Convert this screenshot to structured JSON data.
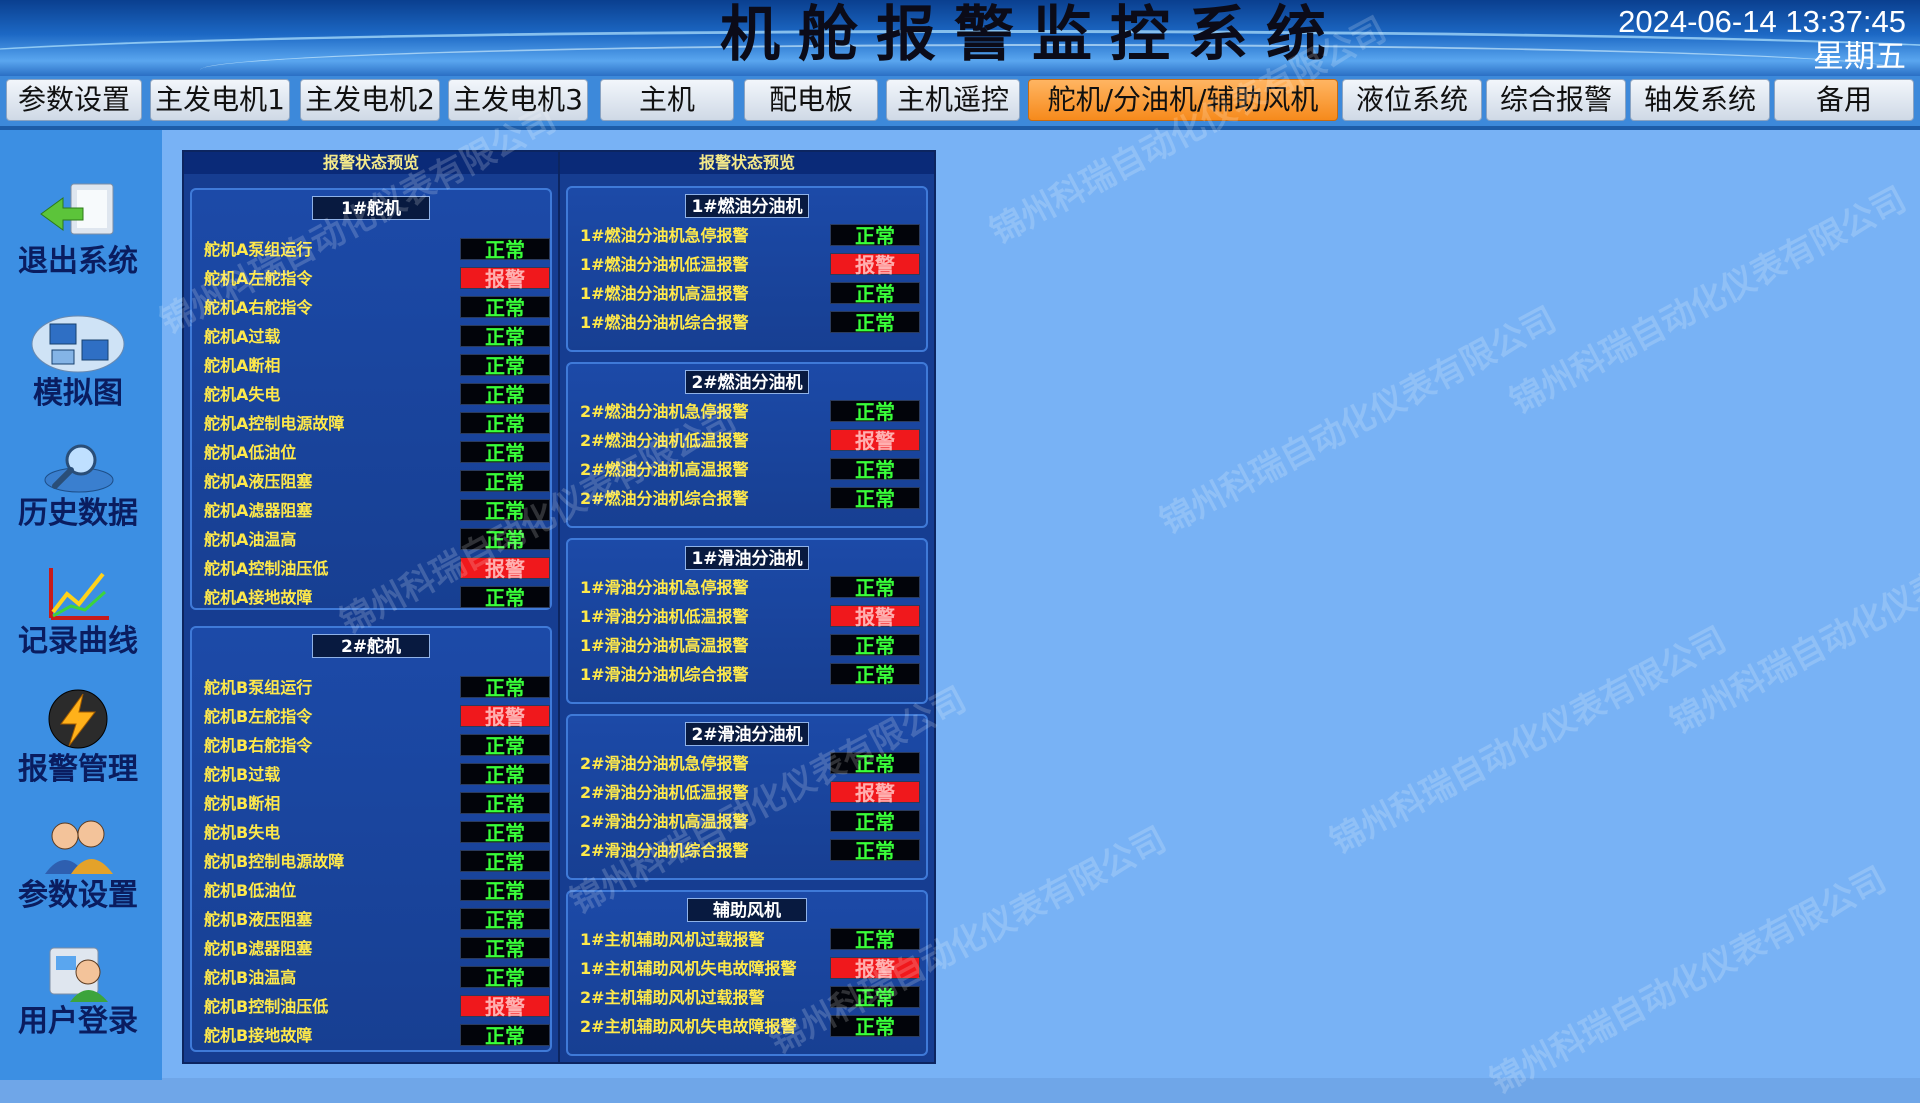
{
  "header": {
    "title": "机舱报警监控系统",
    "datetime": "2024-06-14 13:37:45",
    "weekday": "星期五"
  },
  "nav": {
    "items": [
      "参数设置",
      "主发电机1",
      "主发电机2",
      "主发电机3",
      "主机",
      "配电板",
      "主机遥控",
      "舵机/分油机/辅助风机",
      "液位系统",
      "综合报警",
      "轴发系统",
      "备用"
    ],
    "active_index": 7
  },
  "sidebar": {
    "items": [
      {
        "label": "退出系统",
        "icon": "exit-arrow-icon"
      },
      {
        "label": "模拟图",
        "icon": "monitor-diagram-icon"
      },
      {
        "label": "历史数据",
        "icon": "magnifier-history-icon"
      },
      {
        "label": "记录曲线",
        "icon": "chart-curve-icon"
      },
      {
        "label": "报警管理",
        "icon": "lightning-alarm-icon"
      },
      {
        "label": "参数设置",
        "icon": "users-settings-icon"
      },
      {
        "label": "用户登录",
        "icon": "user-login-icon"
      }
    ]
  },
  "panels": [
    {
      "header": "报警状态预览",
      "groups": [
        {
          "title": "1#舵机",
          "rows": [
            {
              "name": "舵机A泵组运行",
              "status": "正常",
              "alarm": false
            },
            {
              "name": "舵机A左舵指令",
              "status": "报警",
              "alarm": true
            },
            {
              "name": "舵机A右舵指令",
              "status": "正常",
              "alarm": false
            },
            {
              "name": "舵机A过载",
              "status": "正常",
              "alarm": false
            },
            {
              "name": "舵机A断相",
              "status": "正常",
              "alarm": false
            },
            {
              "name": "舵机A失电",
              "status": "正常",
              "alarm": false
            },
            {
              "name": "舵机A控制电源故障",
              "status": "正常",
              "alarm": false
            },
            {
              "name": "舵机A低油位",
              "status": "正常",
              "alarm": false
            },
            {
              "name": "舵机A液压阻塞",
              "status": "正常",
              "alarm": false
            },
            {
              "name": "舵机A滤器阻塞",
              "status": "正常",
              "alarm": false
            },
            {
              "name": "舵机A油温高",
              "status": "正常",
              "alarm": false
            },
            {
              "name": "舵机A控制油压低",
              "status": "报警",
              "alarm": true
            },
            {
              "name": "舵机A接地故障",
              "status": "正常",
              "alarm": false
            }
          ]
        },
        {
          "title": "2#舵机",
          "rows": [
            {
              "name": "舵机B泵组运行",
              "status": "正常",
              "alarm": false
            },
            {
              "name": "舵机B左舵指令",
              "status": "报警",
              "alarm": true
            },
            {
              "name": "舵机B右舵指令",
              "status": "正常",
              "alarm": false
            },
            {
              "name": "舵机B过载",
              "status": "正常",
              "alarm": false
            },
            {
              "name": "舵机B断相",
              "status": "正常",
              "alarm": false
            },
            {
              "name": "舵机B失电",
              "status": "正常",
              "alarm": false
            },
            {
              "name": "舵机B控制电源故障",
              "status": "正常",
              "alarm": false
            },
            {
              "name": "舵机B低油位",
              "status": "正常",
              "alarm": false
            },
            {
              "name": "舵机B液压阻塞",
              "status": "正常",
              "alarm": false
            },
            {
              "name": "舵机B滤器阻塞",
              "status": "正常",
              "alarm": false
            },
            {
              "name": "舵机B油温高",
              "status": "正常",
              "alarm": false
            },
            {
              "name": "舵机B控制油压低",
              "status": "报警",
              "alarm": true
            },
            {
              "name": "舵机B接地故障",
              "status": "正常",
              "alarm": false
            }
          ]
        }
      ]
    },
    {
      "header": "报警状态预览",
      "groups": [
        {
          "title": "1#燃油分油机",
          "rows": [
            {
              "name": "1#燃油分油机急停报警",
              "status": "正常",
              "alarm": false
            },
            {
              "name": "1#燃油分油机低温报警",
              "status": "报警",
              "alarm": true
            },
            {
              "name": "1#燃油分油机高温报警",
              "status": "正常",
              "alarm": false
            },
            {
              "name": "1#燃油分油机综合报警",
              "status": "正常",
              "alarm": false
            }
          ]
        },
        {
          "title": "2#燃油分油机",
          "rows": [
            {
              "name": "2#燃油分油机急停报警",
              "status": "正常",
              "alarm": false
            },
            {
              "name": "2#燃油分油机低温报警",
              "status": "报警",
              "alarm": true
            },
            {
              "name": "2#燃油分油机高温报警",
              "status": "正常",
              "alarm": false
            },
            {
              "name": "2#燃油分油机综合报警",
              "status": "正常",
              "alarm": false
            }
          ]
        },
        {
          "title": "1#滑油分油机",
          "rows": [
            {
              "name": "1#滑油分油机急停报警",
              "status": "正常",
              "alarm": false
            },
            {
              "name": "1#滑油分油机低温报警",
              "status": "报警",
              "alarm": true
            },
            {
              "name": "1#滑油分油机高温报警",
              "status": "正常",
              "alarm": false
            },
            {
              "name": "1#滑油分油机综合报警",
              "status": "正常",
              "alarm": false
            }
          ]
        },
        {
          "title": "2#滑油分油机",
          "rows": [
            {
              "name": "2#滑油分油机急停报警",
              "status": "正常",
              "alarm": false
            },
            {
              "name": "2#滑油分油机低温报警",
              "status": "报警",
              "alarm": true
            },
            {
              "name": "2#滑油分油机高温报警",
              "status": "正常",
              "alarm": false
            },
            {
              "name": "2#滑油分油机综合报警",
              "status": "正常",
              "alarm": false
            }
          ]
        },
        {
          "title": "辅助风机",
          "rows": [
            {
              "name": "1#主机辅助风机过载报警",
              "status": "正常",
              "alarm": false
            },
            {
              "name": "1#主机辅助风机失电故障报警",
              "status": "报警",
              "alarm": true
            },
            {
              "name": "2#主机辅助风机过载报警",
              "status": "正常",
              "alarm": false
            },
            {
              "name": "2#主机辅助风机失电故障报警",
              "status": "正常",
              "alarm": false
            }
          ]
        }
      ]
    }
  ],
  "watermark": "锦州科瑞自动化仪表有限公司",
  "colors": {
    "normal_text": "#39ff39",
    "alarm_bg": "#f0181c",
    "label_text": "#ffe94a",
    "active_tab": "#f68a1c"
  }
}
